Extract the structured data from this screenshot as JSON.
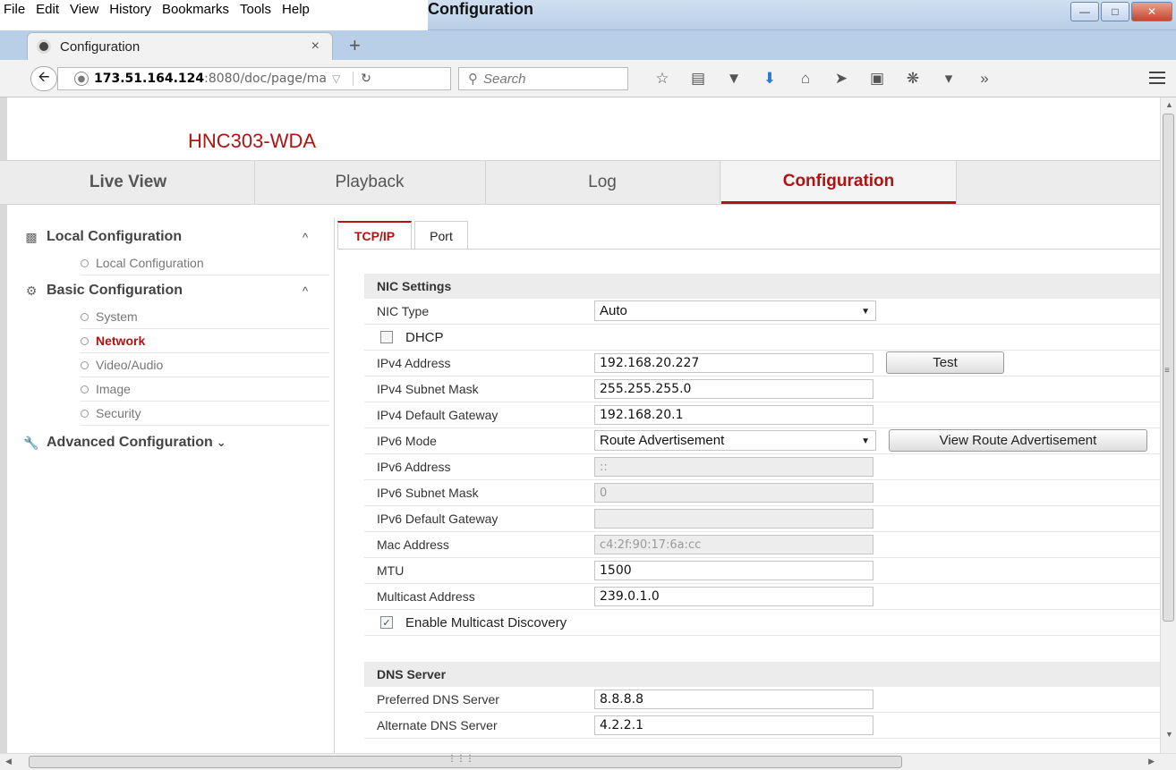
{
  "window": {
    "title": "Configuration",
    "menu": [
      "File",
      "Edit",
      "View",
      "History",
      "Bookmarks",
      "Tools",
      "Help"
    ]
  },
  "browser": {
    "tab_title": "Configuration",
    "url_host": "173.51.164.124",
    "url_path": ":8080/doc/page/ma",
    "search_placeholder": "Search",
    "toolbar_icons": [
      "star-icon",
      "reader-icon",
      "pocket-icon",
      "download-icon",
      "home-icon",
      "send-icon",
      "addon-icon",
      "extension-icon",
      "dropdown-icon",
      "overflow-icon"
    ]
  },
  "header": {
    "model": "HNC303-WDA",
    "nav": [
      "Live View",
      "Playback",
      "Log",
      "Configuration"
    ],
    "active_nav": "Configuration"
  },
  "sidebar": {
    "sections": [
      {
        "label": "Local Configuration",
        "caret": "^",
        "icon": "monitor-icon",
        "items": [
          "Local Configuration"
        ]
      },
      {
        "label": "Basic Configuration",
        "caret": "^",
        "icon": "gear-icon",
        "items": [
          "System",
          "Network",
          "Video/Audio",
          "Image",
          "Security"
        ]
      },
      {
        "label": "Advanced Configuration",
        "caret": "⌄",
        "icon": "wrench-icon",
        "items": []
      }
    ],
    "active_item": "Network"
  },
  "content": {
    "tabs": [
      "TCP/IP",
      "Port"
    ],
    "active_tab": "TCP/IP",
    "nic": {
      "heading": "NIC Settings",
      "nic_type_label": "NIC Type",
      "nic_type_value": "Auto",
      "dhcp_label": "DHCP",
      "dhcp_checked": false,
      "ipv4_address_label": "IPv4 Address",
      "ipv4_address": "192.168.20.227",
      "test_button": "Test",
      "ipv4_subnet_label": "IPv4 Subnet Mask",
      "ipv4_subnet": "255.255.255.0",
      "ipv4_gateway_label": "IPv4 Default Gateway",
      "ipv4_gateway": "192.168.20.1",
      "ipv6_mode_label": "IPv6 Mode",
      "ipv6_mode_value": "Route Advertisement",
      "view_route_button": "View Route Advertisement",
      "ipv6_address_label": "IPv6 Address",
      "ipv6_address": "::",
      "ipv6_subnet_label": "IPv6 Subnet Mask",
      "ipv6_subnet": "0",
      "ipv6_gateway_label": "IPv6 Default Gateway",
      "ipv6_gateway": "",
      "mac_label": "Mac Address",
      "mac": "c4:2f:90:17:6a:cc",
      "mtu_label": "MTU",
      "mtu": "1500",
      "multicast_label": "Multicast Address",
      "multicast": "239.0.1.0",
      "multicast_discovery_label": "Enable Multicast Discovery",
      "multicast_discovery_checked": true
    },
    "dns": {
      "heading": "DNS Server",
      "preferred_label": "Preferred DNS Server",
      "preferred": "8.8.8.8",
      "alternate_label": "Alternate DNS Server",
      "alternate": "4.2.2.1"
    }
  }
}
